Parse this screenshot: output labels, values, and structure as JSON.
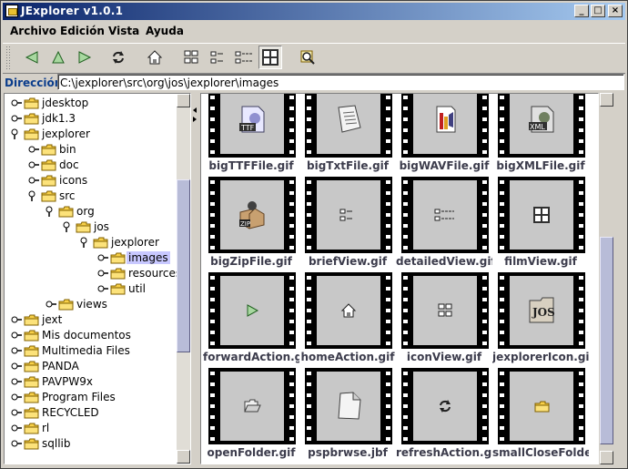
{
  "window": {
    "title": "JExplorer v1.0.1",
    "min": "_",
    "max": "□",
    "close": "×"
  },
  "menu": [
    "Archivo",
    "Edición",
    "Vista",
    "Ayuda"
  ],
  "toolbar": {
    "buttons": [
      "back",
      "up",
      "forward",
      "refresh",
      "home",
      "icon-view",
      "brief-view",
      "detailed-view",
      "film-view",
      "search"
    ],
    "active": "film-view"
  },
  "address": {
    "label": "Dirección:",
    "value": "C:\\jexplorer\\src\\org\\jos\\jexplorer\\images"
  },
  "tree": [
    {
      "label": "jdesktop",
      "depth": 0
    },
    {
      "label": "jdk1.3",
      "depth": 0
    },
    {
      "label": "jexplorer",
      "depth": 0,
      "expanded": true
    },
    {
      "label": "bin",
      "depth": 1
    },
    {
      "label": "doc",
      "depth": 1
    },
    {
      "label": "icons",
      "depth": 1
    },
    {
      "label": "src",
      "depth": 1,
      "expanded": true
    },
    {
      "label": "org",
      "depth": 2,
      "expanded": true
    },
    {
      "label": "jos",
      "depth": 3,
      "expanded": true
    },
    {
      "label": "jexplorer",
      "depth": 4,
      "expanded": true
    },
    {
      "label": "images",
      "depth": 5,
      "selected": true
    },
    {
      "label": "resources",
      "depth": 5
    },
    {
      "label": "util",
      "depth": 5
    },
    {
      "label": "views",
      "depth": 2
    },
    {
      "label": "jext",
      "depth": 0
    },
    {
      "label": "Mis documentos",
      "depth": 0
    },
    {
      "label": "Multimedia Files",
      "depth": 0
    },
    {
      "label": "PANDA",
      "depth": 0
    },
    {
      "label": "PAVPW9x",
      "depth": 0
    },
    {
      "label": "Program Files",
      "depth": 0
    },
    {
      "label": "RECYCLED",
      "depth": 0
    },
    {
      "label": "rl",
      "depth": 0
    },
    {
      "label": "sqllib",
      "depth": 0
    }
  ],
  "files": [
    {
      "name": "bigTTFFile.gif",
      "icon": "ttf-file-icon"
    },
    {
      "name": "bigTxtFile.gif",
      "icon": "text-file-icon"
    },
    {
      "name": "bigWAVFile.gif",
      "icon": "wav-file-icon"
    },
    {
      "name": "bigXMLFile.gif",
      "icon": "xml-file-icon"
    },
    {
      "name": "bigZipFile.gif",
      "icon": "zip-file-icon"
    },
    {
      "name": "briefView.gif",
      "icon": "brief-view-icon"
    },
    {
      "name": "detailedView.gif",
      "icon": "detailed-view-icon"
    },
    {
      "name": "filmView.gif",
      "icon": "film-view-icon"
    },
    {
      "name": "forwardAction.gif",
      "icon": "forward-icon"
    },
    {
      "name": "homeAction.gif",
      "icon": "home-icon"
    },
    {
      "name": "iconView.gif",
      "icon": "icon-view-icon"
    },
    {
      "name": "jexplorerIcon.gif",
      "icon": "jos-logo-icon"
    },
    {
      "name": "openFolder.gif",
      "icon": "open-folder-icon"
    },
    {
      "name": "pspbrwse.jbf",
      "icon": "document-icon"
    },
    {
      "name": "refreshAction.gif",
      "icon": "refresh-icon"
    },
    {
      "name": "smallCloseFolder.gif",
      "icon": "folder-icon"
    }
  ],
  "colors": {
    "title_start": "#0a246a",
    "title_end": "#a6caf0",
    "address_label": "#0b3d8c",
    "caption": "#3c3c4c",
    "selection": "#c8c8ff",
    "scroll_thumb": "#b8bcd8"
  }
}
